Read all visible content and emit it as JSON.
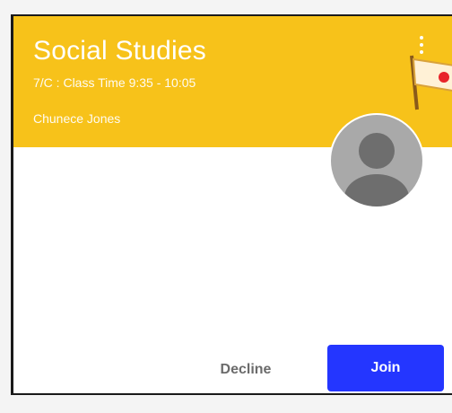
{
  "class_card": {
    "title": "Social Studies",
    "subtitle": "7/C : Class Time 9:35 - 10:05",
    "teacher": "Chunece Jones",
    "banner_color": "#f7c21a",
    "menu_icon": "more-vert-icon",
    "decoration_icon": "flag-icon",
    "avatar_icon": "default-avatar-icon"
  },
  "actions": {
    "decline_label": "Decline",
    "join_label": "Join",
    "join_color": "#2436ff"
  }
}
